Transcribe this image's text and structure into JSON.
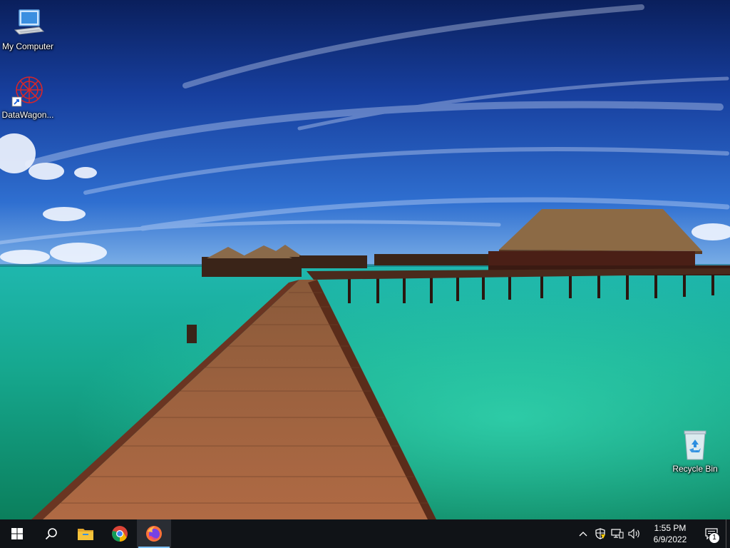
{
  "desktop": {
    "icons": [
      {
        "label": "My Computer",
        "icon": "computer-icon"
      },
      {
        "label": "DataWagon...",
        "icon": "datawagon-shortcut-icon"
      },
      {
        "label": "Recycle Bin",
        "icon": "recycle-bin-icon"
      }
    ]
  },
  "taskbar": {
    "pinned": [
      {
        "name": "start",
        "icon": "windows-logo-icon"
      },
      {
        "name": "search",
        "icon": "search-icon"
      },
      {
        "name": "file-explorer",
        "icon": "folder-icon"
      },
      {
        "name": "chrome",
        "icon": "chrome-icon"
      },
      {
        "name": "firefox",
        "icon": "firefox-icon",
        "active": true
      }
    ],
    "tray": {
      "time": "1:55 PM",
      "date": "6/9/2022",
      "notification_count": "1"
    },
    "colors": {
      "background": "#101317",
      "accent": "#7fc3ff"
    }
  }
}
